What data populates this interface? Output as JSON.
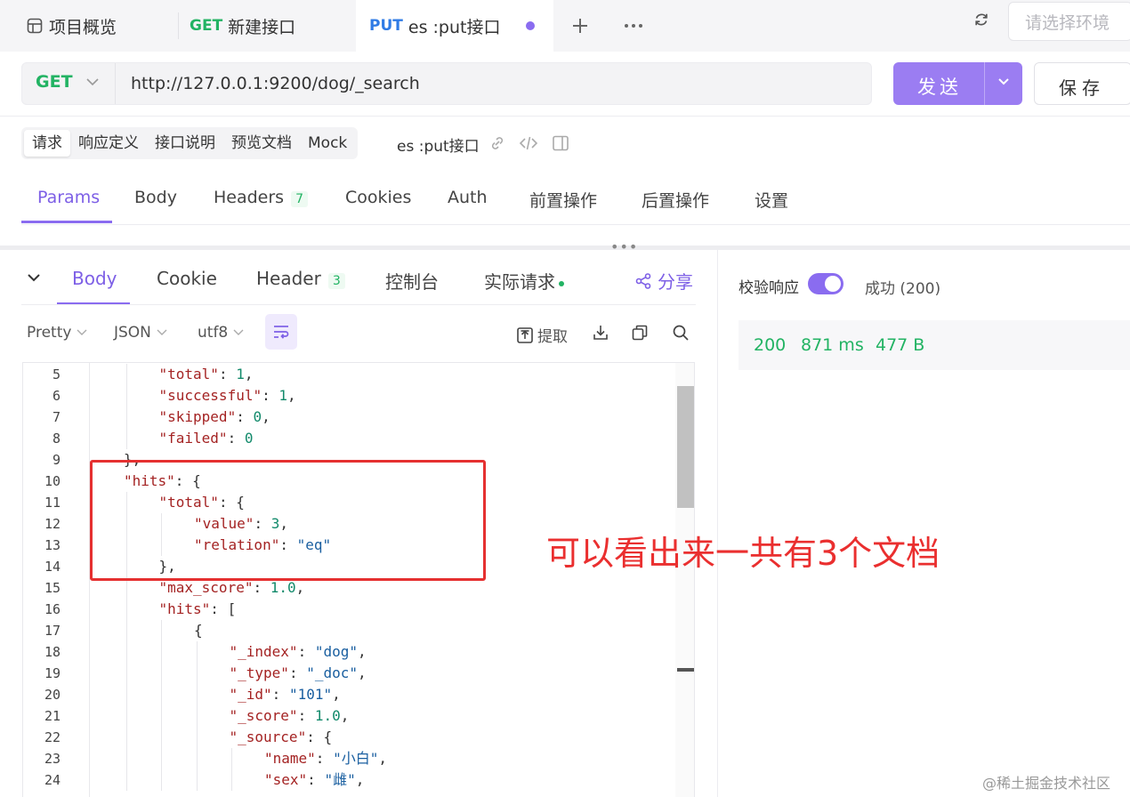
{
  "tabs": [
    {
      "label": "项目概览",
      "icon": "layout-icon"
    },
    {
      "method": "GET",
      "label": "新建接口",
      "method_color": "#22b363"
    },
    {
      "method": "PUT",
      "label": "es :put接口",
      "method_color": "#2f7be5",
      "unsaved": true
    }
  ],
  "env_placeholder": "请选择环境",
  "request": {
    "method": "GET",
    "url": "http://127.0.0.1:9200/dog/_search",
    "send_label": "发送",
    "save_label": "保存"
  },
  "sub_tabs": [
    "请求",
    "响应定义",
    "接口说明",
    "预览文档",
    "Mock"
  ],
  "interface_name": "es :put接口",
  "param_tabs": {
    "params": "Params",
    "body": "Body",
    "headers": "Headers",
    "headers_count": "7",
    "cookies": "Cookies",
    "auth": "Auth",
    "pre": "前置操作",
    "post": "后置操作",
    "settings": "设置"
  },
  "response_tabs": {
    "body": "Body",
    "cookie": "Cookie",
    "header": "Header",
    "header_count": "3",
    "console": "控制台",
    "actual": "实际请求",
    "share": "分享"
  },
  "toolbar": {
    "format": "Pretty",
    "type": "JSON",
    "encoding": "utf8",
    "extract": "提取"
  },
  "code_lines": [
    {
      "n": "5",
      "indent": 2,
      "parts": [
        [
          "k",
          "\"total\""
        ],
        [
          "p",
          ": "
        ],
        [
          "n",
          "1"
        ],
        [
          "p",
          ","
        ]
      ]
    },
    {
      "n": "6",
      "indent": 2,
      "parts": [
        [
          "k",
          "\"successful\""
        ],
        [
          "p",
          ": "
        ],
        [
          "n",
          "1"
        ],
        [
          "p",
          ","
        ]
      ]
    },
    {
      "n": "7",
      "indent": 2,
      "parts": [
        [
          "k",
          "\"skipped\""
        ],
        [
          "p",
          ": "
        ],
        [
          "n",
          "0"
        ],
        [
          "p",
          ","
        ]
      ]
    },
    {
      "n": "8",
      "indent": 2,
      "parts": [
        [
          "k",
          "\"failed\""
        ],
        [
          "p",
          ": "
        ],
        [
          "n",
          "0"
        ]
      ]
    },
    {
      "n": "9",
      "indent": 1,
      "parts": [
        [
          "p",
          "},"
        ]
      ]
    },
    {
      "n": "10",
      "indent": 1,
      "parts": [
        [
          "k",
          "\"hits\""
        ],
        [
          "p",
          ": {"
        ]
      ]
    },
    {
      "n": "11",
      "indent": 2,
      "parts": [
        [
          "k",
          "\"total\""
        ],
        [
          "p",
          ": {"
        ]
      ]
    },
    {
      "n": "12",
      "indent": 3,
      "parts": [
        [
          "k",
          "\"value\""
        ],
        [
          "p",
          ": "
        ],
        [
          "n",
          "3"
        ],
        [
          "p",
          ","
        ]
      ]
    },
    {
      "n": "13",
      "indent": 3,
      "parts": [
        [
          "k",
          "\"relation\""
        ],
        [
          "p",
          ": "
        ],
        [
          "s",
          "\"eq\""
        ]
      ]
    },
    {
      "n": "14",
      "indent": 2,
      "parts": [
        [
          "p",
          "},"
        ]
      ]
    },
    {
      "n": "15",
      "indent": 2,
      "parts": [
        [
          "k",
          "\"max_score\""
        ],
        [
          "p",
          ": "
        ],
        [
          "n",
          "1.0"
        ],
        [
          "p",
          ","
        ]
      ]
    },
    {
      "n": "16",
      "indent": 2,
      "parts": [
        [
          "k",
          "\"hits\""
        ],
        [
          "p",
          ": ["
        ]
      ]
    },
    {
      "n": "17",
      "indent": 3,
      "parts": [
        [
          "p",
          "{"
        ]
      ]
    },
    {
      "n": "18",
      "indent": 4,
      "parts": [
        [
          "k",
          "\"_index\""
        ],
        [
          "p",
          ": "
        ],
        [
          "s",
          "\"dog\""
        ],
        [
          "p",
          ","
        ]
      ]
    },
    {
      "n": "19",
      "indent": 4,
      "parts": [
        [
          "k",
          "\"_type\""
        ],
        [
          "p",
          ": "
        ],
        [
          "s",
          "\"_doc\""
        ],
        [
          "p",
          ","
        ]
      ]
    },
    {
      "n": "20",
      "indent": 4,
      "parts": [
        [
          "k",
          "\"_id\""
        ],
        [
          "p",
          ": "
        ],
        [
          "s",
          "\"101\""
        ],
        [
          "p",
          ","
        ]
      ]
    },
    {
      "n": "21",
      "indent": 4,
      "parts": [
        [
          "k",
          "\"_score\""
        ],
        [
          "p",
          ": "
        ],
        [
          "n",
          "1.0"
        ],
        [
          "p",
          ","
        ]
      ]
    },
    {
      "n": "22",
      "indent": 4,
      "parts": [
        [
          "k",
          "\"_source\""
        ],
        [
          "p",
          ": {"
        ]
      ]
    },
    {
      "n": "23",
      "indent": 5,
      "parts": [
        [
          "k",
          "\"name\""
        ],
        [
          "p",
          ": "
        ],
        [
          "s",
          "\"小白\""
        ],
        [
          "p",
          ","
        ]
      ]
    },
    {
      "n": "24",
      "indent": 5,
      "parts": [
        [
          "k",
          "\"sex\""
        ],
        [
          "p",
          ": "
        ],
        [
          "s",
          "\"雌\""
        ],
        [
          "p",
          ","
        ]
      ]
    }
  ],
  "annotation": "可以看出来一共有3个文档",
  "response_meta": {
    "verify_label": "校验响应",
    "verify_enabled": true,
    "success_label": "成功 (200)",
    "status": "200",
    "time": "871 ms",
    "size": "477 B"
  },
  "watermark": "@稀土掘金技术社区",
  "colors": {
    "accent": "#8a6cf0",
    "success": "#22b363",
    "annotation": "#e53030"
  }
}
